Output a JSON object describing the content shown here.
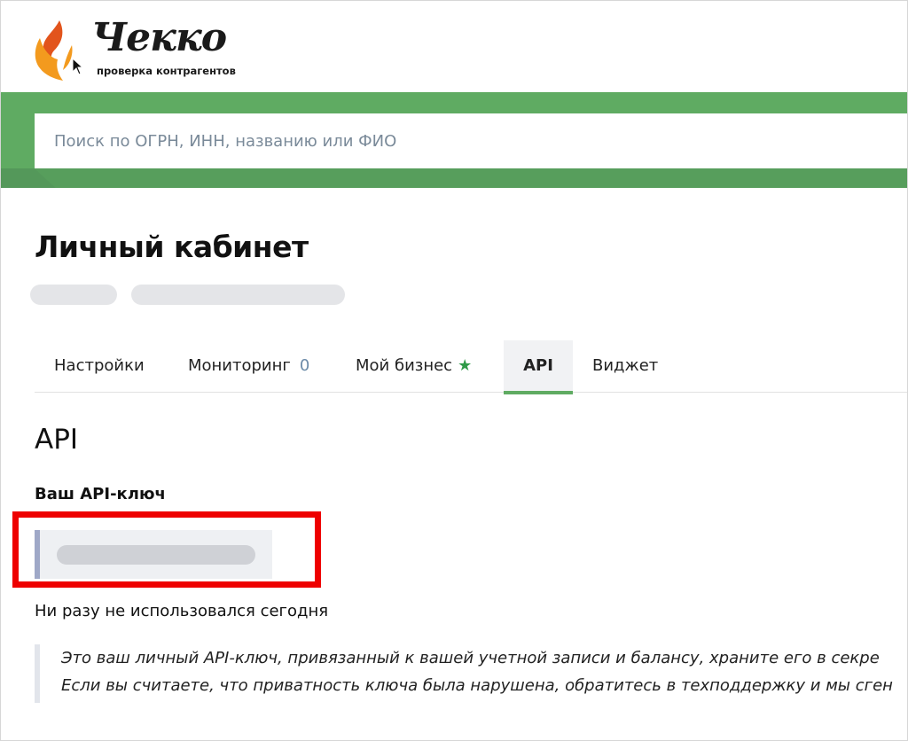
{
  "brand": {
    "name": "Чекко",
    "tagline": "проверка контрагентов",
    "colors": {
      "green": "#5fab62",
      "orange": "#f39a1e",
      "red_orange": "#e2541c"
    }
  },
  "search": {
    "placeholder": "Поиск по ОГРН, ИНН, названию или ФИО"
  },
  "page": {
    "title": "Личный кабинет"
  },
  "tabs": [
    {
      "label": "Настройки"
    },
    {
      "label": "Мониторинг",
      "count": "0"
    },
    {
      "label": "Мой бизнес",
      "icon": "star-icon"
    },
    {
      "label": "API",
      "active": true
    },
    {
      "label": "Виджет"
    }
  ],
  "api": {
    "title": "API",
    "key_label": "Ваш API-ключ",
    "usage_status": "Ни разу не использовался сегодня",
    "notice": [
      "Это ваш личный API-ключ, привязанный к вашей учетной записи и балансу, храните его в секре",
      "Если вы считаете, что приватность ключа была нарушена, обратитесь в техподдержку и мы сген"
    ]
  },
  "colors": {
    "highlight": "#ee0000",
    "tab_underline": "#5fab62",
    "star": "#2f9a48"
  }
}
